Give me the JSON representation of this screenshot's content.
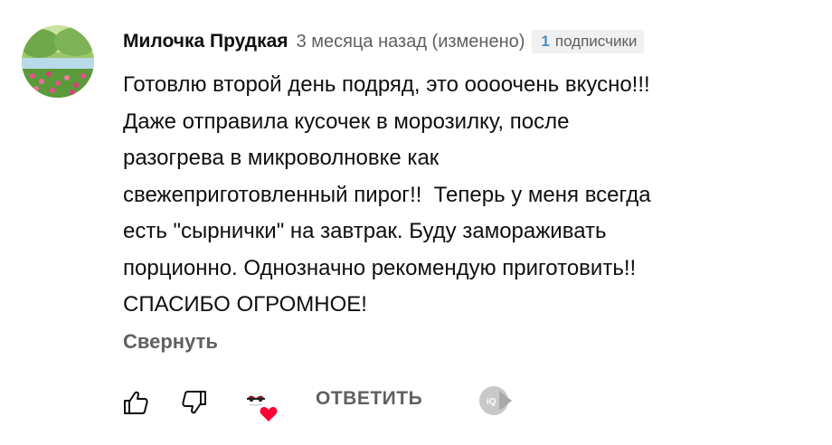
{
  "comment": {
    "author": "Милочка Прудкая",
    "time": "3 месяца назад (изменено)",
    "subscriber_badge": {
      "count": "1",
      "label": "подписчики"
    },
    "text": "Готовлю второй день подряд, это оооочень вкусно!!!\nДаже отправила кусочек в морозилку, после\nразогрева в микроволновке как\nсвежеприготовленный пирог!!  Теперь у меня всегда\nесть \"сырнички\" на завтрак. Буду замораживать\nпорционно. Однозначно рекомендую приготовить!!\nСПАСИБО ОГРОМНОЕ!",
    "collapse_label": "Свернуть"
  },
  "actions": {
    "like_icon": "thumbs-up-icon",
    "dislike_icon": "thumbs-down-icon",
    "creator_heart_icon": "creator-heart-icon",
    "reply_label": "ОТВЕТИТЬ",
    "extension_icon": "iq-extension-icon"
  },
  "colors": {
    "secondary_text": "#606060",
    "heart": "#ff0033",
    "badge_bg": "#f0f0f0"
  }
}
